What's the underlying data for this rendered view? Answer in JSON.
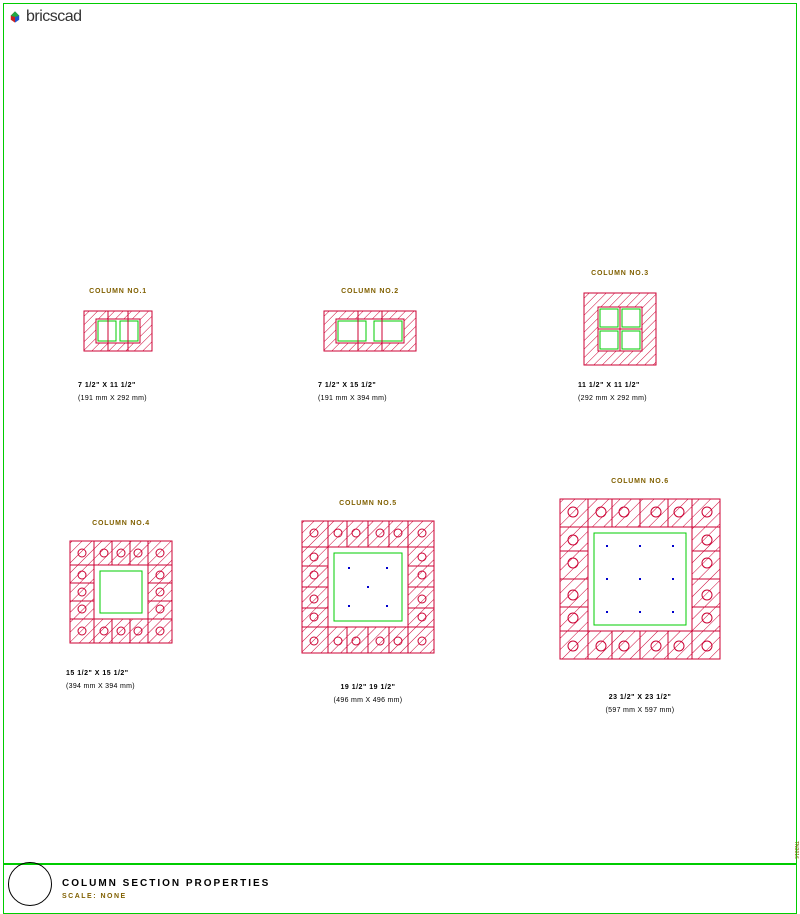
{
  "header": {
    "brand": "bricscad"
  },
  "columns": [
    {
      "label": "COLUMN NO.1",
      "dim_imp": "7 1/2\" X 11 1/2\"",
      "dim_mm": "(191 mm X 292 mm)"
    },
    {
      "label": "COLUMN NO.2",
      "dim_imp": "7 1/2\" X 15 1/2\"",
      "dim_mm": "(191 mm X 394 mm)"
    },
    {
      "label": "COLUMN NO.3",
      "dim_imp": "11 1/2\" X 11 1/2\"",
      "dim_mm": "(292 mm X 292 mm)"
    },
    {
      "label": "COLUMN NO.4",
      "dim_imp": "15 1/2\" X 15 1/2\"",
      "dim_mm": "(394 mm X 394 mm)"
    },
    {
      "label": "COLUMN NO.5",
      "dim_imp": "19 1/2\" 19 1/2\"",
      "dim_mm": "(496 mm X 496 mm)"
    },
    {
      "label": "COLUMN NO.6",
      "dim_imp": "23 1/2\" X 23 1/2\"",
      "dim_mm": "(597 mm X 597 mm)"
    }
  ],
  "title": {
    "main": "COLUMN SECTION PROPERTIES",
    "scale": "SCALE: NONE"
  },
  "side_code": "TN3916"
}
